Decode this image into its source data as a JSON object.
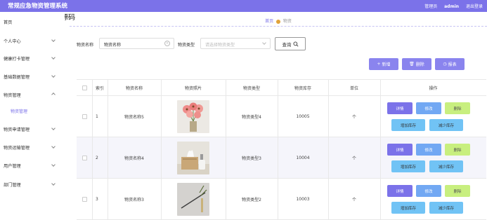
{
  "header": {
    "app_title": "常规应急物资管理系统",
    "role_label": "管理员",
    "username": "admin",
    "logout_label": "退出登录"
  },
  "watermark": "猫头鹰源码",
  "sidebar": {
    "items": [
      {
        "label": "首页"
      },
      {
        "label": "个人中心"
      },
      {
        "label": "健康打卡管理"
      },
      {
        "label": "基础数据管理"
      },
      {
        "label": "物资管理"
      },
      {
        "label": "物资申请管理"
      },
      {
        "label": "物资运输管理"
      },
      {
        "label": "用户管理"
      },
      {
        "label": "部门管理"
      }
    ],
    "active_sub": "物资管理"
  },
  "breadcrumb": {
    "home": "首页",
    "current": "物资"
  },
  "search": {
    "name_label": "物资名称",
    "name_value": "物资名称",
    "type_label": "物资类型",
    "type_placeholder": "请选择物资类型",
    "query_label": "查询"
  },
  "toolbar": {
    "add_label": "新增",
    "delete_label": "删除",
    "report_label": "报表"
  },
  "table": {
    "columns": [
      "索引",
      "物资名称",
      "物资照片",
      "物资类型",
      "物资库存",
      "单位",
      "操作"
    ],
    "rows": [
      {
        "index": "1",
        "name": "物资名称5",
        "type": "物资类型4",
        "stock": "10005",
        "unit": "个"
      },
      {
        "index": "2",
        "name": "物资名称4",
        "type": "物资类型3",
        "stock": "10004",
        "unit": "个"
      },
      {
        "index": "3",
        "name": "物资名称3",
        "type": "物资类型2",
        "stock": "10003",
        "unit": "个"
      }
    ],
    "op_labels": {
      "detail": "详情",
      "edit": "修改",
      "delete": "删除",
      "increase": "增加库存",
      "decrease": "减少库存"
    }
  },
  "colors": {
    "accent": "#7b72e9",
    "detail_button": "#7b72e9",
    "edit_button": "#72a8f3",
    "delete_button": "#c8ef7f",
    "stock_button": "#71c3f5"
  }
}
